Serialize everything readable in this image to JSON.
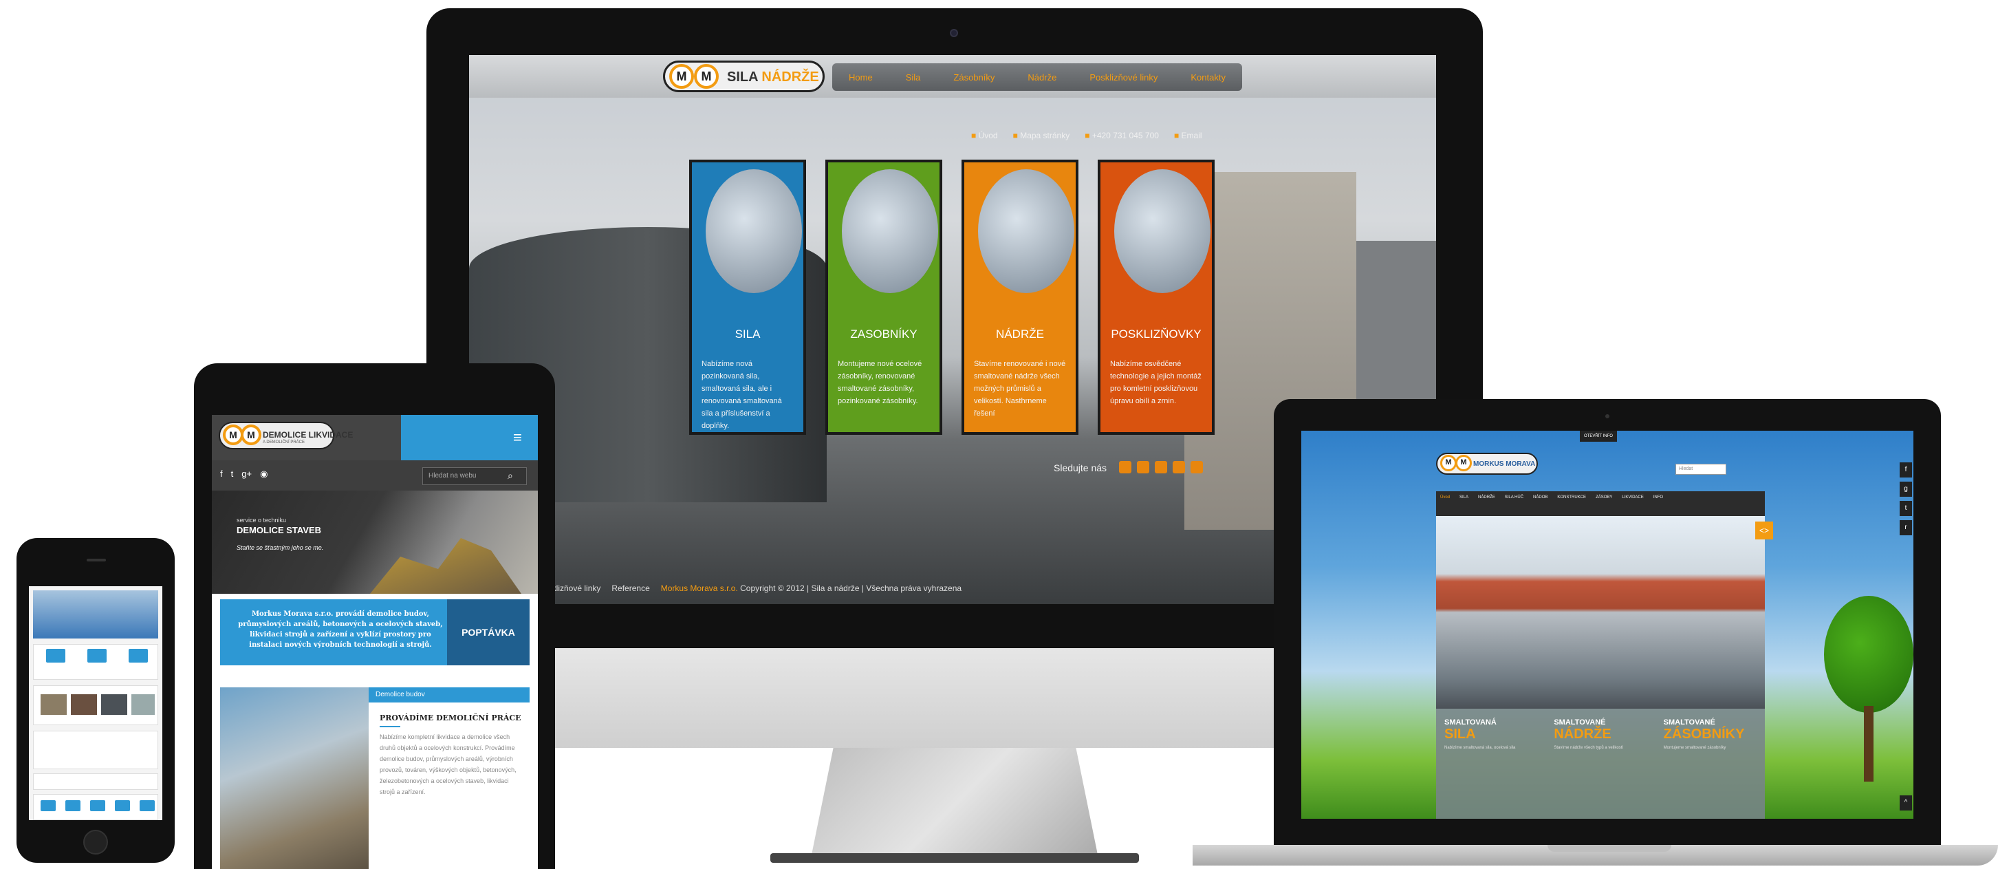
{
  "imac": {
    "logo": {
      "mark": "M",
      "brand_a": "SILA",
      "brand_b": "NÁDRŽE"
    },
    "nav": [
      "Home",
      "Sila",
      "Zásobníky",
      "Nádrže",
      "Posklizňové linky",
      "Kontakty"
    ],
    "top_links": [
      "Úvod",
      "Mapa stránky",
      "+420 731 045 700",
      "Email"
    ],
    "cards": [
      {
        "title": "SILA",
        "text": "Nabízíme nová pozinkovaná sila, smaltovaná sila, ale i renovovaná smaltovaná sila a příslušenství a doplňky."
      },
      {
        "title": "ZASOBNÍKY",
        "text": "Montujeme nové ocelové zásobníky, renovované smaltované zásobníky, pozinkované zásobníky."
      },
      {
        "title": "NÁDRŽE",
        "text": "Stavíme renovované i nové smaltované nádrže všech možných průmislů a velikostí. Nasthrneme řešení"
      },
      {
        "title": "POSKLIZŇOVKY",
        "text": "Nabízíme osvědčené technologie a jejich montáž pro komletní posklizňovou úpravu obilí a zrnin."
      }
    ],
    "follow_label": "Sledujte nás",
    "footer": {
      "link1": "Posklizňové linky",
      "link2": "Reference",
      "company": "Morkus Morava s.r.o.",
      "copyright": "Copyright © 2012 | Sila a nádrže | Všechna práva vyhrazena"
    }
  },
  "tablet": {
    "logo_mark": "M",
    "logo_text": "DEMOLICE LIKVIDACE",
    "logo_sub": "A DEMOLIČNÍ PRÁCE",
    "search_placeholder": "Hledat na webu",
    "hero": {
      "kicker": "service o techniku",
      "title": "DEMOLICE STAVEB",
      "cta": "Staňte se šťastným jeho se me."
    },
    "banner_text": "Morkus Morava s.r.o. provádí demolice budov, průmyslových areálů, betonových a ocelových staveb, likvidaci strojů a zařízení a vyklízí prostory pro instalaci nových výrobních technologií a strojů.",
    "banner_button": "POPTÁVKA",
    "article": {
      "tag": "Demolice budov",
      "heading": "PROVÁDÍME DEMOLIČNÍ PRÁCE",
      "text": "Nabízíme kompletní likvidace a demolice všech druhů objektů a ocelových konstrukcí. Provádíme demolice budov, průmyslových areálů, výrobních provozů, továren, výškových objektů, betonových, železobetonových a ocelových staveb, likvidaci strojů a zařízení."
    }
  },
  "laptop": {
    "top_tab": "OTEVŘÍT INFO",
    "logo_mark": "M",
    "logo_text": "MORKUS MORAVA",
    "search_placeholder": "Hledat",
    "nav": [
      "Úvod",
      "SILA",
      "NÁDRŽE",
      "SILA HÚČ",
      "NÁDOB",
      "KONSTRUKCE",
      "ZÁSOBY",
      "LIKVIDACE",
      "INFO"
    ],
    "boxes": [
      {
        "small": "SMALTOVANÁ",
        "big": "SILA",
        "text": "Nabízíme smaltovaná sila, ocelová sila"
      },
      {
        "small": "SMALTOVANÉ",
        "big": "NÁDRŽE",
        "text": "Stavíme nádrže všech typů a velikostí"
      },
      {
        "small": "SMALTOVANÉ",
        "big": "ZÁSOBNÍKY",
        "text": "Montujeme smaltované zásobníky"
      }
    ]
  }
}
